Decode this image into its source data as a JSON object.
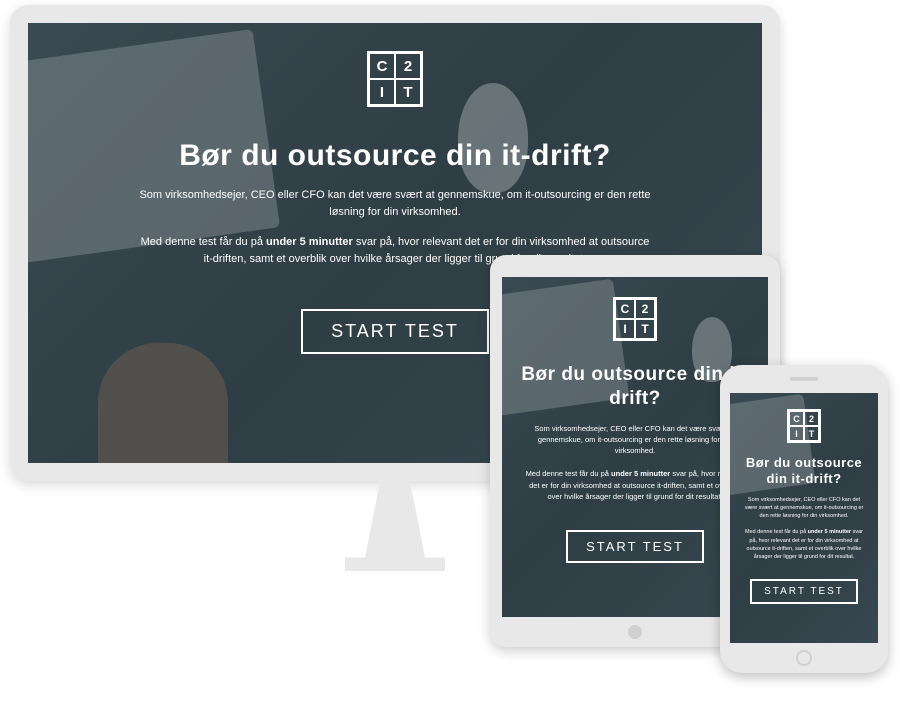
{
  "logo": {
    "c1": "C",
    "c2": "2",
    "c3": "I",
    "c4": "T"
  },
  "headline": "Bør du outsource din it-drift?",
  "para1": "Som virksomhedsejer, CEO eller CFO kan det være svært at gennemskue, om it-outsourcing er den rette løsning for din virksomhed.",
  "para2_pre": "Med denne test får du på ",
  "para2_bold": "under 5 minutter",
  "para2_post": " svar på, hvor relevant det er for din virksomhed at outsource it-driften, samt et overblik over hvilke årsager der ligger til grund for dit resultat.",
  "button": "START TEST"
}
